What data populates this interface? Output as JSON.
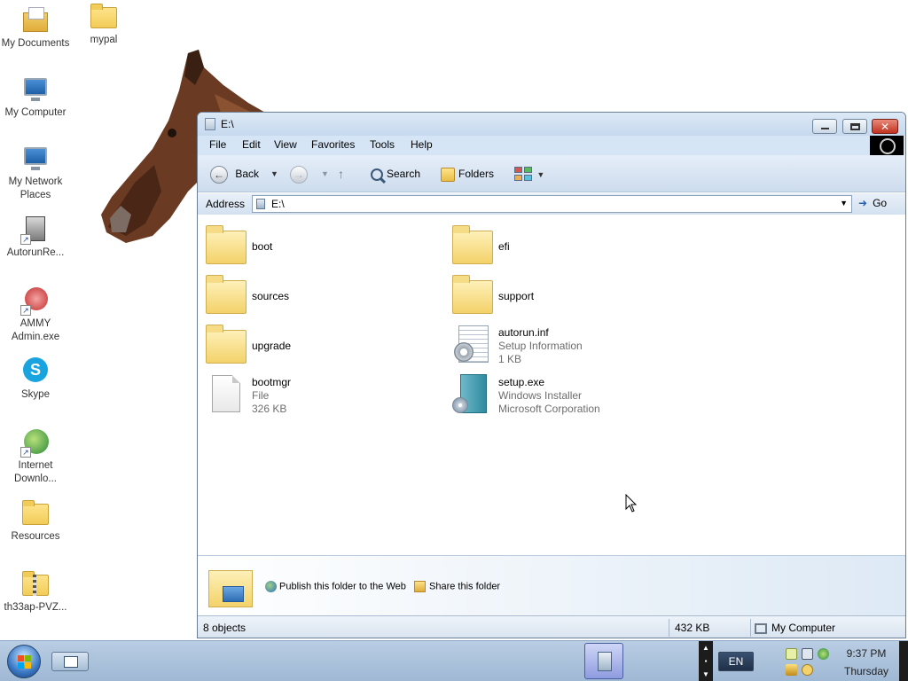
{
  "desktop": {
    "icons": [
      {
        "label": "My Documents"
      },
      {
        "label": "mypal"
      },
      {
        "label": "My Computer"
      },
      {
        "label": "My Network Places"
      },
      {
        "label": "AutorunRe..."
      },
      {
        "label": "AMMY Admin.exe"
      },
      {
        "label": "Skype"
      },
      {
        "label": "Internet Downlo..."
      },
      {
        "label": "Resources"
      },
      {
        "label": "th33ap-PVZ..."
      }
    ]
  },
  "window": {
    "title": "E:\\",
    "menu": [
      "File",
      "Edit",
      "View",
      "Favorites",
      "Tools",
      "Help"
    ],
    "toolbar": {
      "back_label": "Back",
      "search_label": "Search",
      "folders_label": "Folders"
    },
    "address": {
      "label": "Address",
      "value": "E:\\",
      "go_label": "Go"
    },
    "items": [
      {
        "name": "boot",
        "type": "folder"
      },
      {
        "name": "efi",
        "type": "folder"
      },
      {
        "name": "sources",
        "type": "folder"
      },
      {
        "name": "support",
        "type": "folder"
      },
      {
        "name": "upgrade",
        "type": "folder"
      },
      {
        "name": "autorun.inf",
        "type": "inf",
        "line2": "Setup Information",
        "line3": "1 KB"
      },
      {
        "name": "bootmgr",
        "type": "file",
        "line2": "File",
        "line3": "326 KB"
      },
      {
        "name": "setup.exe",
        "type": "exe",
        "line2": "Windows Installer",
        "line3": "Microsoft Corporation"
      }
    ],
    "taskpane": {
      "publish_label": "Publish this folder to the Web",
      "share_label": "Share this folder"
    },
    "status": {
      "objects": "8 objects",
      "size": "432 KB",
      "zone": "My Computer"
    }
  },
  "taskbar": {
    "language": "EN",
    "time": "9:37 PM",
    "day": "Thursday"
  },
  "colors": {
    "window_frame": "#6a7e96",
    "menubar": "#d6e5f5",
    "folder_yellow": "#f4d26a",
    "taskbar": "#a9c0da"
  }
}
